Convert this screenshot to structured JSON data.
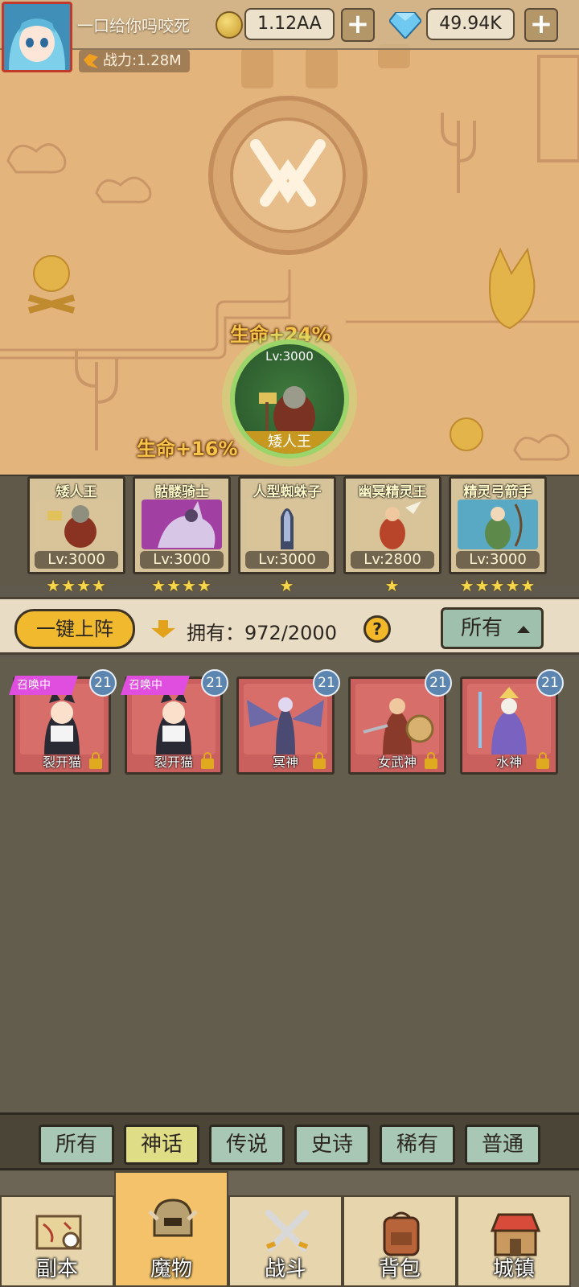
{
  "player": {
    "name": "一口给你吗咬死",
    "power": "战力:1.28M"
  },
  "currency": {
    "gold": "1.12AA",
    "gems": "49.94K",
    "add_symbol": "+"
  },
  "featured": {
    "bonus": "生命+24%",
    "level": "Lv:3000",
    "name": "矮人王"
  },
  "second_bonus": {
    "bonus": "生命+16%"
  },
  "team": [
    {
      "name": "矮人王",
      "level": "Lv:3000",
      "stars": 4,
      "stars_text": "★★★★",
      "color": "#d9c49a"
    },
    {
      "name": "骷髅骑士",
      "level": "Lv:3000",
      "stars": 4,
      "stars_text": "★★★★",
      "color": "#a23fa2"
    },
    {
      "name": "人型蜘蛛子",
      "level": "Lv:3000",
      "stars": 1,
      "stars_text": "★",
      "color": "#d9c49a"
    },
    {
      "name": "幽冥精灵王",
      "level": "Lv:2800",
      "stars": 1,
      "stars_text": "★",
      "color": "#d9c49a"
    },
    {
      "name": "精灵弓箭手",
      "level": "Lv:3000",
      "stars": 5,
      "stars_text": "★★★★★",
      "color": "#5aa9c4"
    }
  ],
  "controls": {
    "deploy_label": "一键上阵",
    "owned_text": "拥有：972/2000",
    "help_symbol": "?",
    "filter_label": "所有"
  },
  "collection": [
    {
      "name": "裂开猫",
      "badge": "21",
      "ribbon": "召唤中"
    },
    {
      "name": "裂开猫",
      "badge": "21",
      "ribbon": "召唤中"
    },
    {
      "name": "冥神",
      "badge": "21",
      "ribbon": ""
    },
    {
      "name": "女武神",
      "badge": "21",
      "ribbon": ""
    },
    {
      "name": "水神",
      "badge": "21",
      "ribbon": ""
    }
  ],
  "rarity_tabs": [
    {
      "label": "所有",
      "active": false
    },
    {
      "label": "神话",
      "active": true
    },
    {
      "label": "传说",
      "active": false
    },
    {
      "label": "史诗",
      "active": false
    },
    {
      "label": "稀有",
      "active": false
    },
    {
      "label": "普通",
      "active": false
    }
  ],
  "nav": [
    {
      "label": "副本",
      "icon": "map-scroll-icon",
      "active": false
    },
    {
      "label": "魔物",
      "icon": "monster-helmet-icon",
      "active": true
    },
    {
      "label": "战斗",
      "icon": "crossed-swords-icon",
      "active": false
    },
    {
      "label": "背包",
      "icon": "backpack-icon",
      "active": false
    },
    {
      "label": "城镇",
      "icon": "town-shop-icon",
      "active": false
    }
  ],
  "colors": {
    "accent": "#f1b92e",
    "active_tab": "#dfdd86",
    "tab": "#a8c7b5",
    "card_red": "#c9605d"
  }
}
